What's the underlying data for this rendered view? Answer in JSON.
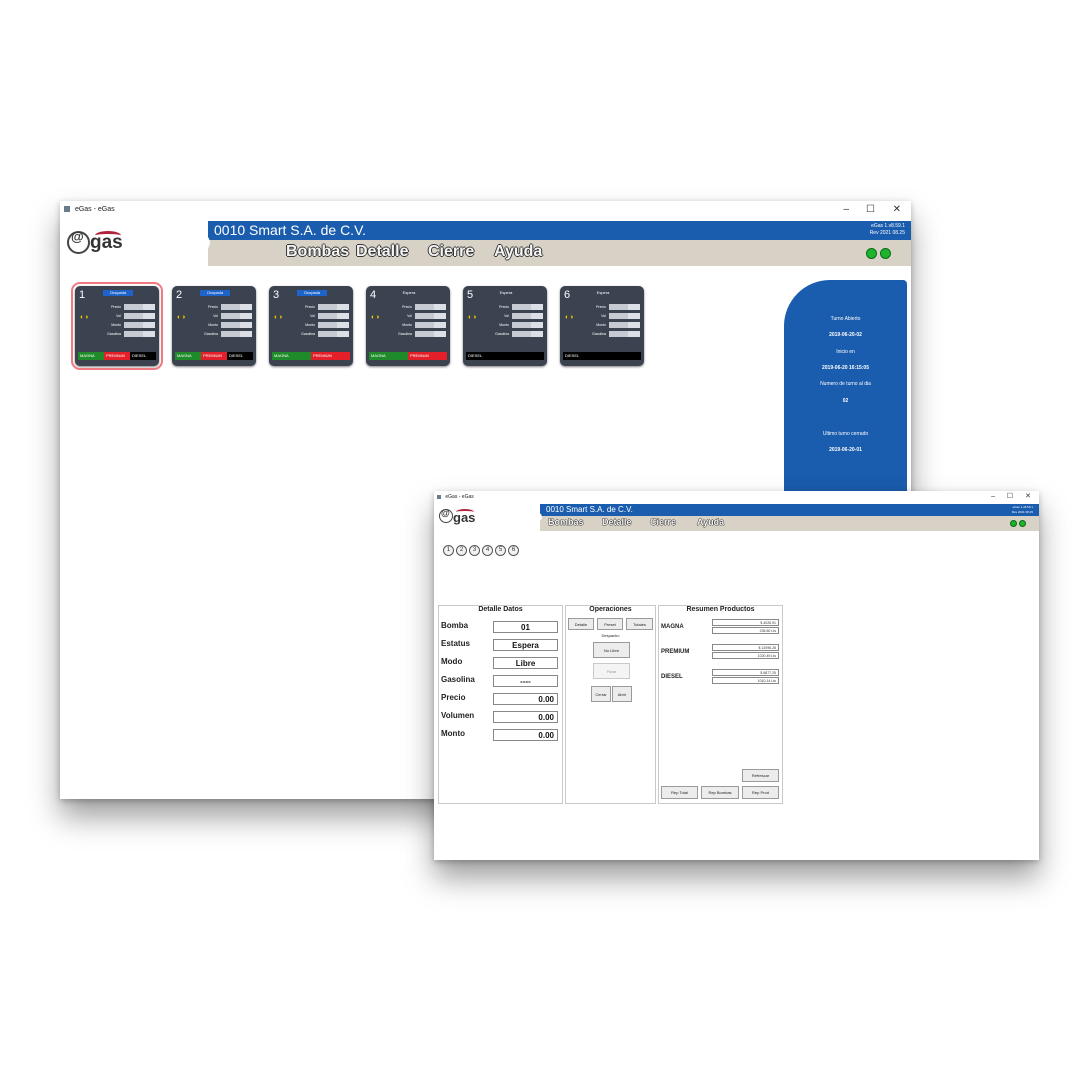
{
  "main_window": {
    "title": "eGas - eGas",
    "controls": [
      "–",
      "☐",
      "✕"
    ],
    "company": "0010 Smart S.A. de C.V.",
    "version_line1": "eGas 1.v8.59.1",
    "version_line2": "Rev 2021 08.25",
    "logo_text": "gas",
    "menu": [
      "Bombas",
      "Detalle",
      "Cierre",
      "Ayuda"
    ],
    "pumps": [
      {
        "number": "1",
        "status": "Ocupada",
        "products": [
          "MAGNA",
          "PREMIUM",
          "DIESEL"
        ]
      },
      {
        "number": "2",
        "status": "Ocupada",
        "products": [
          "MAGNA",
          "PREMIUM",
          "DIESEL"
        ]
      },
      {
        "number": "3",
        "status": "Ocupada",
        "products": [
          "MAGNA",
          "PREMIUM"
        ]
      },
      {
        "number": "4",
        "status": "Espera",
        "products": [
          "MAGNA",
          "PREMIUM"
        ]
      },
      {
        "number": "5",
        "status": "Espera",
        "products": [
          "DIESEL"
        ]
      },
      {
        "number": "6",
        "status": "Espera",
        "products": [
          "DIESEL"
        ]
      }
    ],
    "pump_fields": [
      "Precio",
      "Vol",
      "Monto",
      "Gasolina"
    ],
    "shift_panel": {
      "open_label": "Turno Abierto",
      "open_value": "2019-06-20-02",
      "start_label": "Inicio en",
      "start_value": "2019-06-20 16:15:05",
      "number_label": "Numero de turno al dia",
      "number_value": "02",
      "closed_label": "Ultimo turno cerrado",
      "closed_value": "2019-06-20-01"
    }
  },
  "detail_window": {
    "title": "eGas - eGas",
    "controls": [
      "–",
      "☐",
      "✕"
    ],
    "company": "0010 Smart S.A. de C.V.",
    "version_line1": "eGas 1.v8.59.1",
    "version_line2": "Rev 2021 08.25",
    "logo_text": "gas",
    "menu": [
      "Bombas",
      "Detalle",
      "Cierre",
      "Ayuda"
    ],
    "pump_icons": [
      "1",
      "2",
      "3",
      "4",
      "5",
      "6"
    ],
    "detalle": {
      "title": "Detalle Datos",
      "rows": [
        {
          "label": "Bomba",
          "value": "01"
        },
        {
          "label": "Estatus",
          "value": "Espera"
        },
        {
          "label": "Modo",
          "value": "Libre"
        },
        {
          "label": "Gasolina",
          "value": "----"
        },
        {
          "label": "Precio",
          "value": "0.00"
        },
        {
          "label": "Volumen",
          "value": "0.00"
        },
        {
          "label": "Monto",
          "value": "0.00"
        }
      ]
    },
    "operaciones": {
      "title": "Operaciones",
      "tab_buttons": [
        "Detalle",
        "Preset",
        "Totales"
      ],
      "subtitle": "Despacho",
      "no_libre": "No Libre",
      "parar": "Parar",
      "cerrar": "Cerrar",
      "abrir": "Abrir"
    },
    "resumen": {
      "title": "Resumen Productos",
      "products": [
        {
          "name": "MAGNA",
          "amount": "$ 4026.91",
          "volume": "235.60 Lts"
        },
        {
          "name": "PREMIUM",
          "amount": "$ 12096.28",
          "volume": "1020.49 Lts"
        },
        {
          "name": "DIESEL",
          "amount": "$ 6877.25",
          "volume": "1010.14 Lts"
        }
      ],
      "refresh": "Refrescar",
      "buttons": [
        "Rep Total",
        "Rep Bombas",
        "Rep Prod"
      ]
    }
  },
  "colors": {
    "brand_blue": "#1a5cad",
    "menu_bar": "#d7d2c5",
    "pump_card": "#3c4350",
    "magna": "#1f8a2a",
    "premium": "#e3202a",
    "diesel": "#000000",
    "status_ok": "#1db32a",
    "selection": "#f07a82"
  }
}
